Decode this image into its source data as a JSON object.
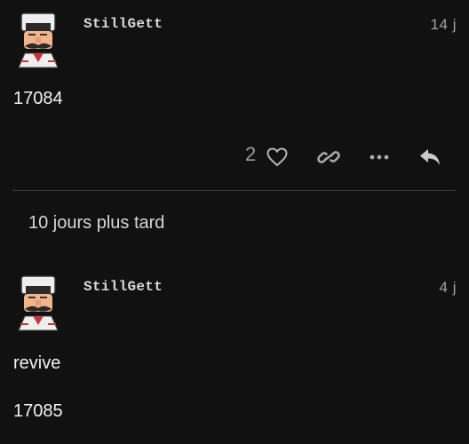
{
  "posts": [
    {
      "username": "StillGett",
      "date": "14 j",
      "body": [
        "17084"
      ],
      "likes": "2",
      "icons": [
        "heart-icon",
        "link-icon",
        "more-icon",
        "reply-icon"
      ]
    },
    {
      "username": "StillGett",
      "date": "4 j",
      "body": [
        "revive",
        "17085"
      ]
    }
  ],
  "time_gap": "10 jours plus tard",
  "colors": {
    "background": "#111111",
    "text": "#f2f2f2",
    "muted": "#9a9a9a",
    "divider": "#3a3a3a"
  }
}
